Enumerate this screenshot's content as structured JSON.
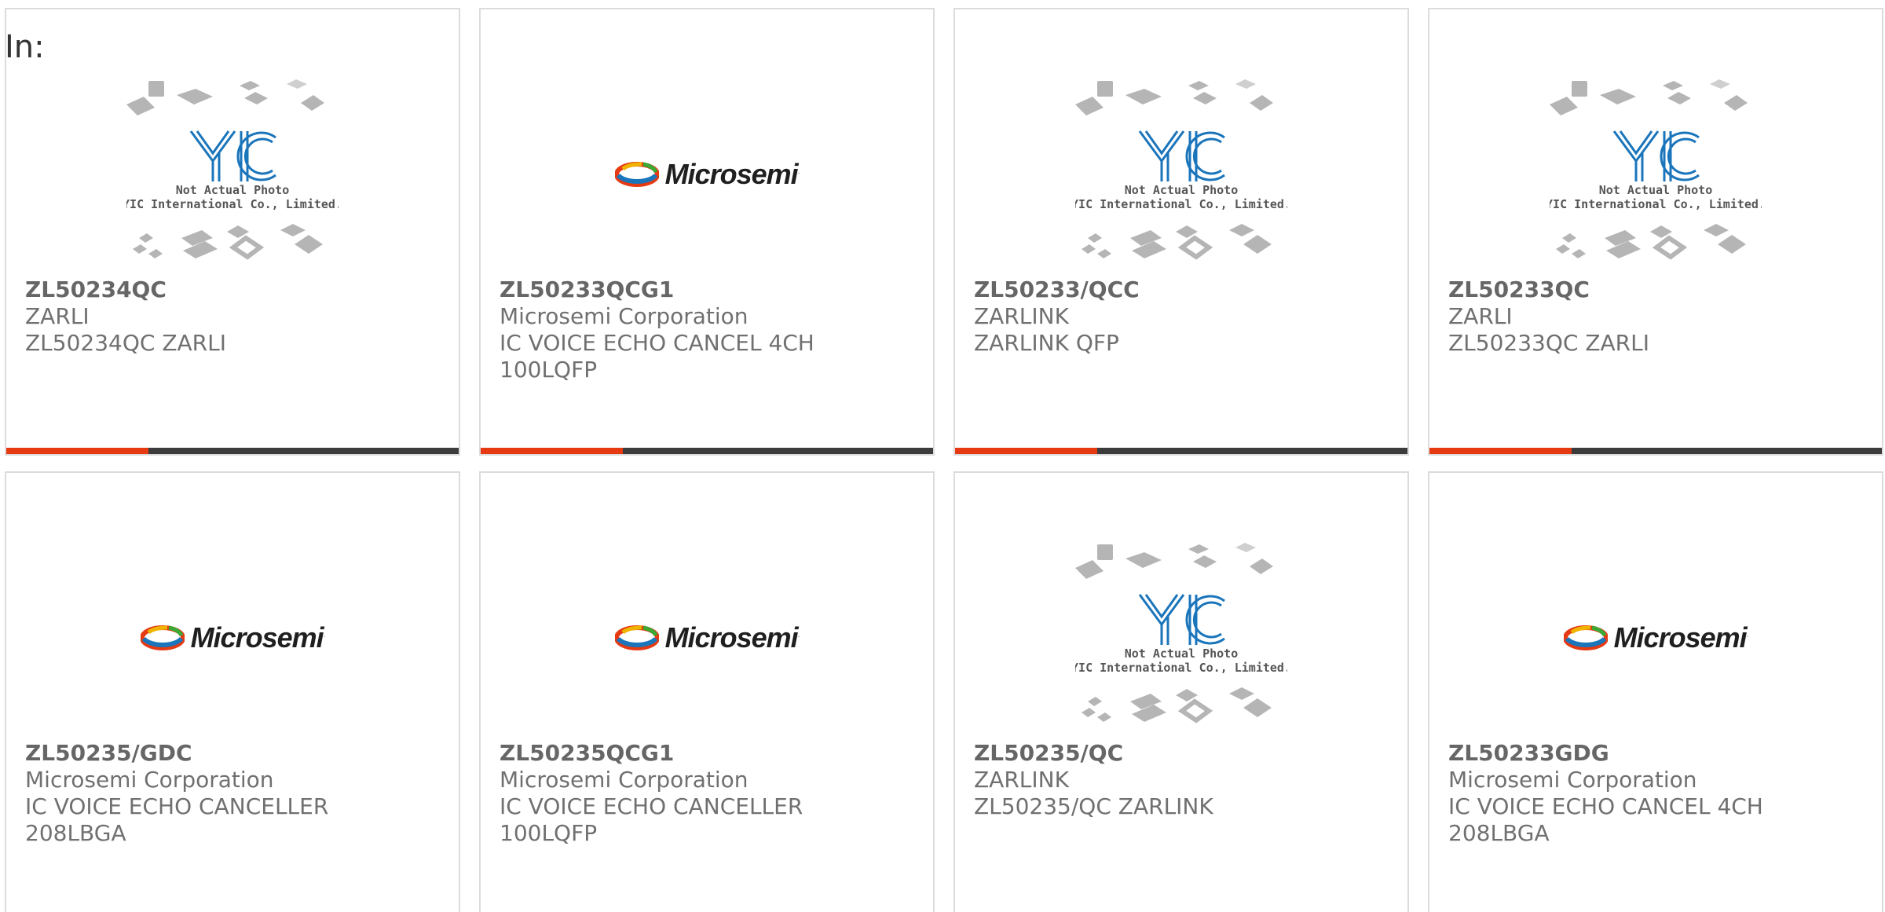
{
  "header": {
    "in_label": "In:"
  },
  "placeholder": {
    "brand": "YIC",
    "note_line1": "Not Actual Photo",
    "note_line2": "YIC International Co., Limited."
  },
  "microsemi_logo": {
    "word": "Microsemi",
    "mark": "."
  },
  "colors": {
    "accent": "#e53a12",
    "bar": "#3c3c3c",
    "border": "#dcdcdc",
    "yic_blue": "#1b75bb"
  },
  "cards": [
    {
      "part": "ZL50234QC",
      "manufacturer": "ZARLI",
      "desc1": "ZL50234QC ZARLI",
      "desc2": "",
      "image": "yic-placeholder"
    },
    {
      "part": "ZL50233QCG1",
      "manufacturer": "Microsemi Corporation",
      "desc1": "IC VOICE ECHO CANCEL 4CH",
      "desc2": "100LQFP",
      "image": "microsemi-logo"
    },
    {
      "part": "ZL50233/QCC",
      "manufacturer": "ZARLINK",
      "desc1": "ZARLINK QFP",
      "desc2": "",
      "image": "yic-placeholder"
    },
    {
      "part": "ZL50233QC",
      "manufacturer": "ZARLI",
      "desc1": "ZL50233QC ZARLI",
      "desc2": "",
      "image": "yic-placeholder"
    },
    {
      "part": "ZL50235/GDC",
      "manufacturer": "Microsemi Corporation",
      "desc1": "IC VOICE ECHO CANCELLER",
      "desc2": "208LBGA",
      "image": "microsemi-logo"
    },
    {
      "part": "ZL50235QCG1",
      "manufacturer": "Microsemi Corporation",
      "desc1": "IC VOICE ECHO CANCELLER",
      "desc2": "100LQFP",
      "image": "microsemi-logo"
    },
    {
      "part": "ZL50235/QC",
      "manufacturer": "ZARLINK",
      "desc1": "ZL50235/QC ZARLINK",
      "desc2": "",
      "image": "yic-placeholder"
    },
    {
      "part": "ZL50233GDG",
      "manufacturer": "Microsemi Corporation",
      "desc1": "IC VOICE ECHO CANCEL 4CH",
      "desc2": "208LBGA",
      "image": "microsemi-logo"
    }
  ]
}
